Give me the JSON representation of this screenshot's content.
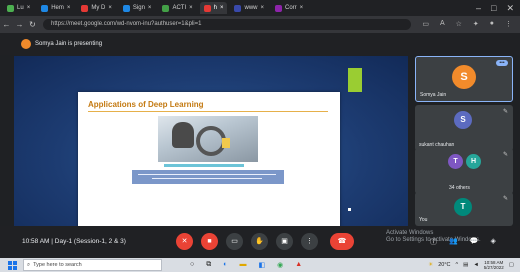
{
  "browser": {
    "tabs": [
      {
        "label": "Lu",
        "color": "#4caf50",
        "active": false
      },
      {
        "label": "Hem",
        "color": "#1e88e5",
        "active": false
      },
      {
        "label": "My D",
        "color": "#e53935",
        "active": false
      },
      {
        "label": "Sign",
        "color": "#1e88e5",
        "active": false
      },
      {
        "label": "ACTI",
        "color": "#43a047",
        "active": false
      },
      {
        "label": "h",
        "color": "#e53935",
        "active": true
      },
      {
        "label": "www",
        "color": "#3949ab",
        "active": false
      },
      {
        "label": "Corr",
        "color": "#8e24aa",
        "active": false
      }
    ],
    "url": "https://meet.google.com/wd-nvom-inu?authuser=1&pli=1"
  },
  "header": {
    "avatar_letter": "S",
    "presenting_text": "Somya Jain is presenting"
  },
  "slide": {
    "title": "Applications of Deep Learning"
  },
  "participants": [
    {
      "name": "Somya Jain",
      "letter": "S",
      "color": "#f28b2b",
      "active": true,
      "more_label": "•••"
    },
    {
      "name": "sukant chauhan",
      "letter": "S",
      "color": "#5c6bc0",
      "active": false
    },
    {
      "name": "34 others",
      "letters": [
        "T",
        "H"
      ],
      "colors": [
        "#7e57c2",
        "#26a69a"
      ],
      "active": false
    },
    {
      "name": "You",
      "letter": "T",
      "color": "#00897b",
      "active": false
    }
  ],
  "controls": {
    "meeting_info": "10:58 AM  |  Day-1 (Session-1, 2 & 3)",
    "activate_line1": "Activate Windows",
    "activate_line2": "Go to Settings to activate Windows."
  },
  "taskbar": {
    "search_placeholder": "Type here to search",
    "weather": "20°C",
    "time": "10:58 AM",
    "date": "5/27/2022"
  }
}
